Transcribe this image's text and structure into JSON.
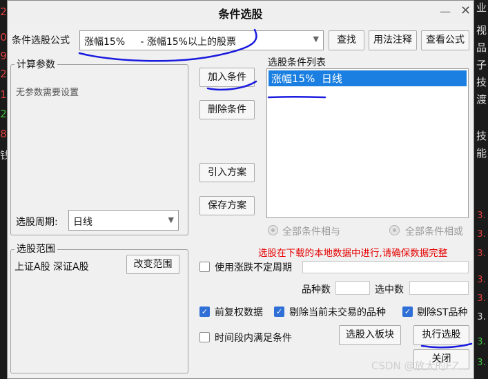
{
  "background": {
    "left_glyphs": [
      "2",
      "0",
      "9",
      "2",
      "1",
      "2",
      "8",
      "钱"
    ],
    "right_chars": [
      "业",
      "视",
      "品",
      "子",
      "技",
      "渡",
      "技",
      "能"
    ],
    "right_numbers": [
      "3.",
      "3.",
      "3.",
      "3.",
      "3.",
      "3.",
      "3.",
      "3."
    ]
  },
  "dialog": {
    "title": "条件选股",
    "formula_label": "条件选股公式",
    "formula_value": "涨幅15%     - 涨幅15%以上的股票",
    "find_label": "查找",
    "usage_label": "用法注释",
    "view_formula_label": "查看公式",
    "params_legend": "计算参数",
    "params_empty": "无参数需要设置",
    "period_label": "选股周期:",
    "period_value": "日线",
    "add_condition": "加入条件",
    "delete_condition": "删除条件",
    "import_plan": "引入方案",
    "save_plan": "保存方案",
    "condition_list_label": "选股条件列表",
    "conditions": [
      "涨幅15%  日线"
    ],
    "and_label": "全部条件相与",
    "or_label": "全部条件相或",
    "warning": "选股在下载的本地数据中进行,请确保数据完整",
    "warning_color": "#e60000",
    "scope_legend": "选股范围",
    "scope_value": "上证A股 深证A股",
    "change_scope": "改变范围",
    "use_variable_period": "使用涨跌不定周期",
    "variety_count_label": "品种数",
    "selected_count_label": "选中数",
    "pre_adjust": "前复权数据",
    "exclude_untraded": "剔除当前未交易的品种",
    "exclude_st": "剔除ST品种",
    "satisfy_in_period": "时间段内满足条件",
    "select_to_block": "选股入板块",
    "execute": "执行选股",
    "close": "关闭",
    "accent_color": "#1a7fe0"
  },
  "watermark": "CSDN @放大的EZ"
}
